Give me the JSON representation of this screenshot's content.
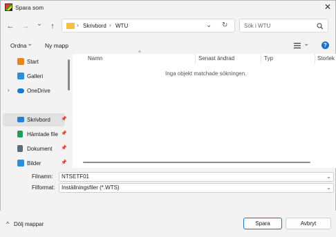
{
  "window": {
    "title": "Spara som",
    "close_glyph": "✕"
  },
  "nav": {
    "back_glyph": "←",
    "forward_glyph": "→",
    "recent_glyph": "⌄",
    "up_glyph": "↑",
    "breadcrumb": [
      "Skrivbord",
      "WTU"
    ],
    "sep_glyph": "›",
    "refresh_glyph": "↻",
    "search_placeholder": "Sök i WTU"
  },
  "toolbar": {
    "organize": "Ordna",
    "new_folder": "Ny mapp",
    "help_glyph": "?"
  },
  "sidebar": {
    "items": [
      {
        "label": "Start",
        "icon": "home-icon",
        "color": "#e8841a",
        "pinned": false
      },
      {
        "label": "Galleri",
        "icon": "gallery-icon",
        "color": "#2d8fd8",
        "pinned": false
      },
      {
        "label": "OneDrive",
        "icon": "onedrive-icon",
        "color": "#1d77d2",
        "pinned": false,
        "expandable": true
      },
      {
        "label": "Skrivbord",
        "icon": "desktop-icon",
        "color": "#2a7fd4",
        "pinned": true
      },
      {
        "label": "Hämtade file",
        "icon": "download-icon",
        "color": "#1f9e5c",
        "pinned": true
      },
      {
        "label": "Dokument",
        "icon": "document-icon",
        "color": "#5c6b7a",
        "pinned": true
      },
      {
        "label": "Bilder",
        "icon": "pictures-icon",
        "color": "#2d8fd8",
        "pinned": true
      }
    ]
  },
  "list": {
    "columns": [
      "Namn",
      "Senast ändrad",
      "Typ",
      "Storlek"
    ],
    "empty_message": "Inga objekt matchade sökningen."
  },
  "form": {
    "filename_label": "Filnamn:",
    "filename_value": "NTSETF01",
    "filetype_label": "Filformat:",
    "filetype_value": "Inställningsfiler (*.WTS)"
  },
  "footer": {
    "hide_folders": "Dölj mappar",
    "save": "Spara",
    "cancel": "Avbryt"
  },
  "colors": {
    "accent": "#1a73c7"
  }
}
